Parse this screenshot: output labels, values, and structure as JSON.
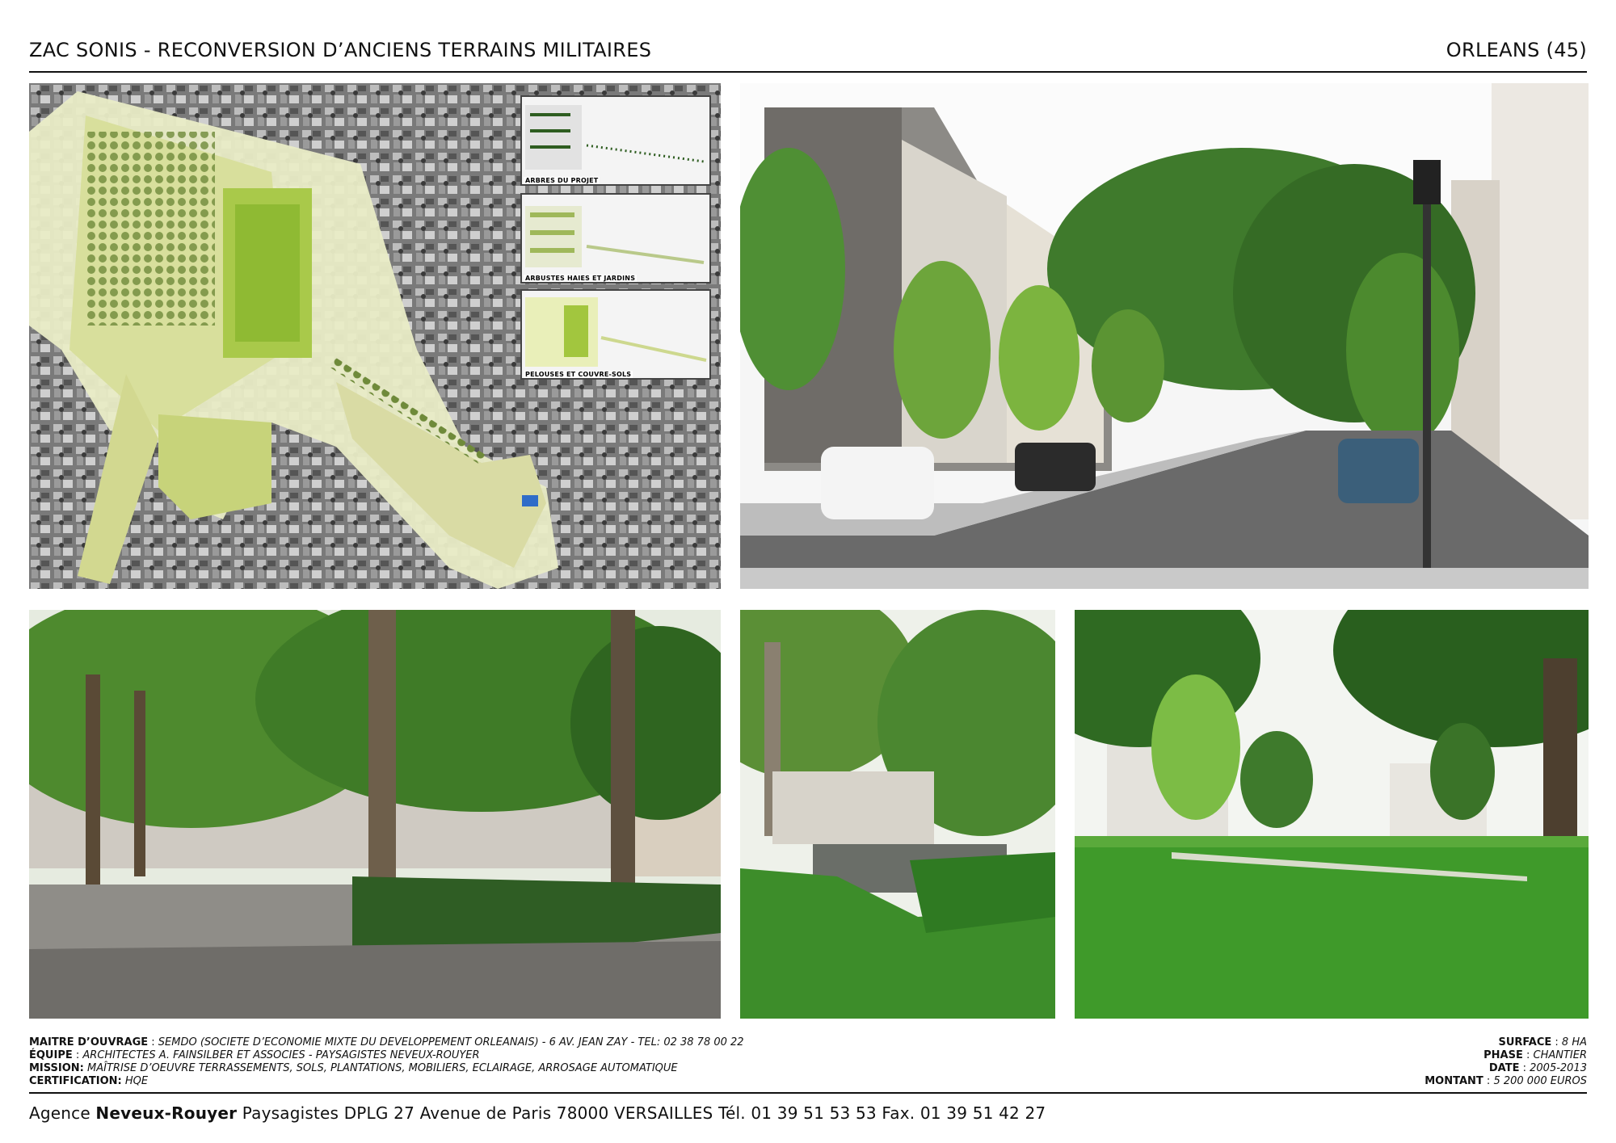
{
  "header": {
    "title": "ZAC SONIS - RECONVERSION D’ANCIENS TERRAINS MILITAIRES",
    "location": "ORLEANS (45)"
  },
  "plan": {
    "legend": [
      {
        "label": "ARBRES DU PROJET"
      },
      {
        "label": "ARBUSTES HAIES ET JARDINS"
      },
      {
        "label": "PELOUSES ET COUVRE-SOLS"
      }
    ]
  },
  "credits": {
    "maitre_label": "MAITRE D’OUVRAGE",
    "maitre_value": "SEMDO (SOCIETE D’ECONOMIE MIXTE DU DEVELOPPEMENT ORLEANAIS) - 6 AV. JEAN ZAY - TEL: 02 38 78 00 22",
    "equipe_label": "ÉQUIPE",
    "equipe_value": "ARCHITECTES  A. FAINSILBER ET ASSOCIES - PAYSAGISTES  NEVEUX-ROUYER",
    "mission_label": "MISSION:",
    "mission_value": "MAÎTRISE D’OEUVRE TERRASSEMENTS, SOLS, PLANTATIONS, MOBILIERS, ECLAIRAGE, ARROSAGE AUTOMATIQUE",
    "certification_label": "CERTIFICATION:",
    "certification_value": "HQE"
  },
  "facts": {
    "surface_label": "SURFACE",
    "surface_value": "8 HA",
    "phase_label": "PHASE",
    "phase_value": "CHANTIER",
    "date_label": "DATE",
    "date_value": "2005-2013",
    "montant_label": "MONTANT",
    "montant_value": "5 200 000  EUROS"
  },
  "footer": {
    "prefix": "Agence ",
    "name": "Neveux-Rouyer",
    "rest": " Paysagistes DPLG 27 Avenue de Paris 78000 VERSAILLES Tél. 01 39 51 53 53 Fax. 01 39 51 42 27"
  },
  "colors": {
    "grass": "#3f9a2a",
    "foliage": "#4c8a2e",
    "plan_green": "#c8d86a",
    "rule": "#111111"
  }
}
